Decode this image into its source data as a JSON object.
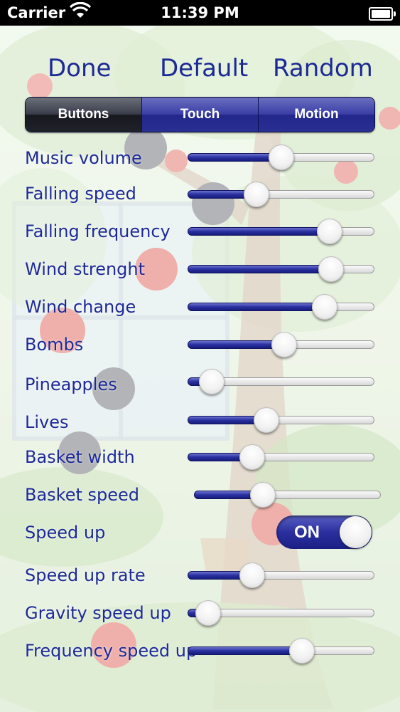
{
  "status_bar": {
    "carrier": "Carrier",
    "time": "11:39 PM",
    "wifi_icon": "wifi-icon",
    "battery_icon": "battery-icon"
  },
  "top_buttons": {
    "done": "Done",
    "default": "Default",
    "random": "Random"
  },
  "segments": [
    {
      "label": "Buttons",
      "selected": true
    },
    {
      "label": "Touch",
      "selected": false
    },
    {
      "label": "Motion",
      "selected": false
    }
  ],
  "settings": {
    "music_volume": {
      "label": "Music volume",
      "value": 0.5
    },
    "falling_speed": {
      "label": "Falling speed",
      "value": 0.35
    },
    "falling_frequency": {
      "label": "Falling frequency",
      "value": 0.8
    },
    "wind_strenght": {
      "label": "Wind strenght",
      "value": 0.81
    },
    "wind_change": {
      "label": "Wind change",
      "value": 0.77
    },
    "bombs": {
      "label": "Bombs",
      "value": 0.52
    },
    "pineapples": {
      "label": "Pineapples",
      "value": 0.07
    },
    "lives": {
      "label": "Lives",
      "value": 0.41
    },
    "basket_width": {
      "label": "Basket width",
      "value": 0.32
    },
    "basket_speed": {
      "label": "Basket speed",
      "value": 0.35
    },
    "speed_up": {
      "label": "Speed up",
      "toggle_text": "ON",
      "on": true
    },
    "speed_up_rate": {
      "label": "Speed up rate",
      "value": 0.32
    },
    "gravity_speed_up": {
      "label": "Gravity speed up",
      "value": 0.05
    },
    "frequency_speed_up": {
      "label": "Frequency speed up",
      "value": 0.63
    }
  },
  "colors": {
    "label_blue": "#1d2a96",
    "slider_fill": "#2a31a0",
    "segment_selected": "#1f2229"
  }
}
